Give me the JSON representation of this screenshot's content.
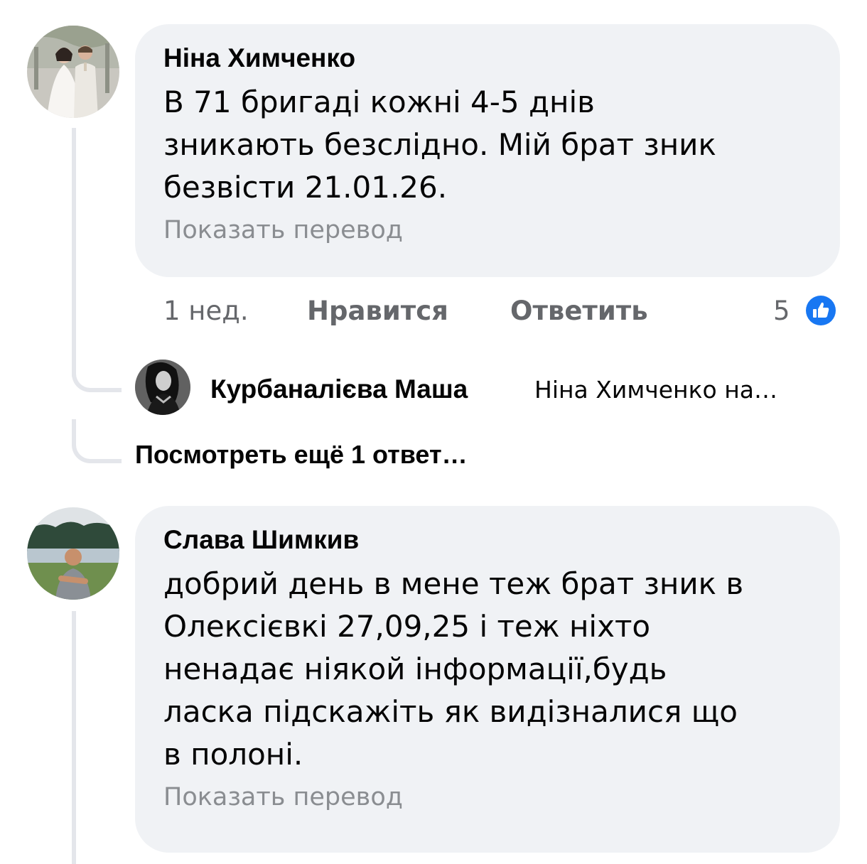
{
  "comments": [
    {
      "author": "Ніна Химченко",
      "text": "В 71 бригаді кожні 4-5 днів\nзникають безслідно. Мій брат зник\nбезвісти 21.01.26.",
      "translate_label": "Показать перевод",
      "time": "1 нед.",
      "like_label": "Нравится",
      "reply_label": "Ответить",
      "reaction_count": "5",
      "reaction_icon": "like-icon",
      "avatar_icon": "wedding-couple-photo",
      "replies_preview": {
        "author": "Курбаналієва Маша",
        "snippet": "Ніна Химченко на…",
        "avatar_icon": "woman-portrait-photo"
      },
      "more_replies_label": "Посмотреть ещё 1 ответ…"
    },
    {
      "author": "Слава Шимкив",
      "text": "добрий день в мене теж брат зник в\nОлексієвкі 27,09,25 і теж ніхто\nненадає ніякой інформації,будь\nласка підскажіть як видізналися що\nв полоні.",
      "translate_label": "Показать перевод",
      "avatar_icon": "man-by-lake-photo"
    }
  ],
  "colors": {
    "bubble_bg": "#f0f2f5",
    "muted_text": "#65676b",
    "link_gray": "#8a8d91",
    "like_blue": "#1877f2",
    "thread_line": "#e4e6eb"
  }
}
